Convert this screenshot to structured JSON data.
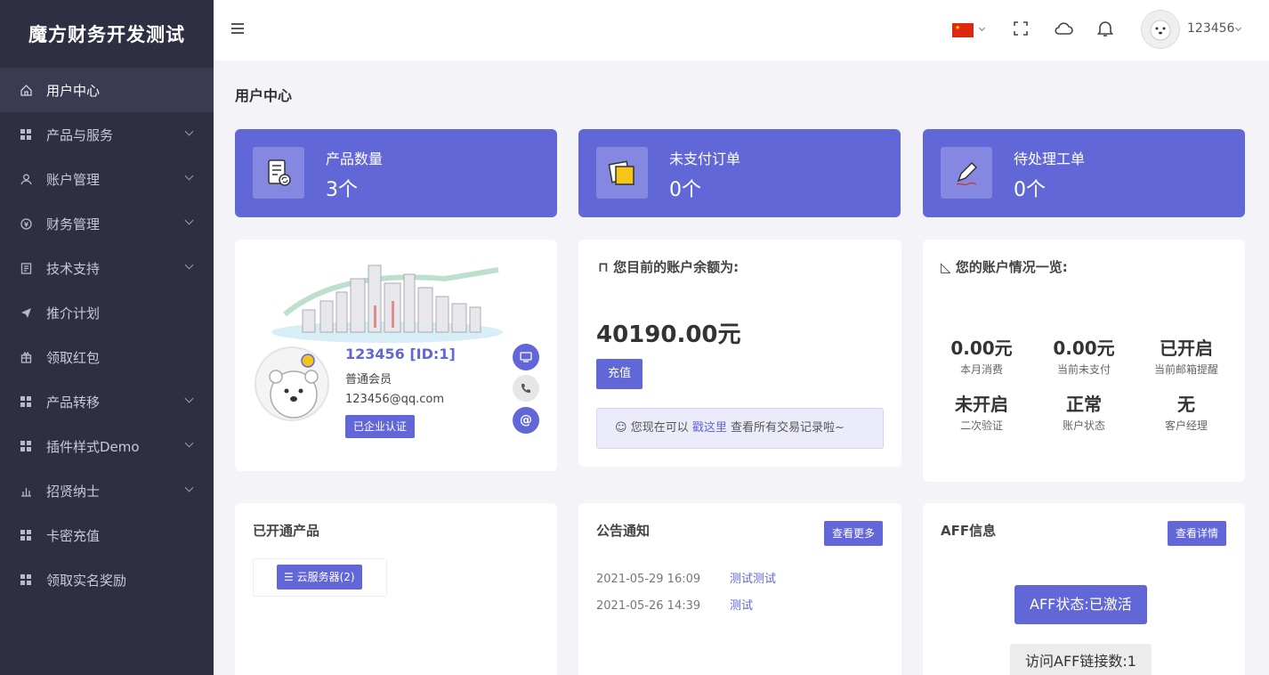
{
  "brand": "魔方财务开发测试",
  "sidebar": {
    "items": [
      {
        "label": "用户中心",
        "icon": "home-icon",
        "active": true,
        "expandable": false
      },
      {
        "label": "产品与服务",
        "icon": "grid-icon",
        "expandable": true
      },
      {
        "label": "账户管理",
        "icon": "user-icon",
        "expandable": true
      },
      {
        "label": "财务管理",
        "icon": "money-icon",
        "expandable": true
      },
      {
        "label": "技术支持",
        "icon": "document-icon",
        "expandable": true
      },
      {
        "label": "推介计划",
        "icon": "send-icon",
        "expandable": false
      },
      {
        "label": "领取红包",
        "icon": "gift-icon",
        "expandable": false
      },
      {
        "label": "产品转移",
        "icon": "grid-icon",
        "expandable": true
      },
      {
        "label": "插件样式Demo",
        "icon": "grid-icon",
        "expandable": true
      },
      {
        "label": "招贤纳士",
        "icon": "bar-chart-icon",
        "expandable": true
      },
      {
        "label": "卡密充值",
        "icon": "grid-icon",
        "expandable": false
      },
      {
        "label": "领取实名奖励",
        "icon": "grid-icon",
        "expandable": false
      }
    ]
  },
  "topbar": {
    "username": "123456",
    "language_flag": "china-flag-icon"
  },
  "page_title": "用户中心",
  "stats": [
    {
      "label": "产品数量",
      "value": "3个",
      "icon": "product-list-icon"
    },
    {
      "label": "未支付订单",
      "value": "0个",
      "icon": "sticky-note-icon"
    },
    {
      "label": "待处理工单",
      "value": "0个",
      "icon": "pen-icon"
    }
  ],
  "profile": {
    "name": "123456 [ID:1]",
    "level": "普通会员",
    "email": "123456@qq.com",
    "verify_label": "已企业认证"
  },
  "balance": {
    "heading": "您目前的账户余额为:",
    "amount": "40190.00元",
    "recharge_label": "充值",
    "tip_prefix": "您现在可以",
    "tip_link": "戳这里",
    "tip_suffix": "查看所有交易记录啦~"
  },
  "overview": {
    "heading": "您的账户情况一览:",
    "items": [
      {
        "value": "0.00元",
        "label": "本月消费"
      },
      {
        "value": "0.00元",
        "label": "当前未支付"
      },
      {
        "value": "已开启",
        "label": "当前邮箱提醒"
      },
      {
        "value": "未开启",
        "label": "二次验证"
      },
      {
        "value": "正常",
        "label": "账户状态"
      },
      {
        "value": "无",
        "label": "客户经理"
      }
    ]
  },
  "products": {
    "heading": "已开通产品",
    "button": "云服务器(2)"
  },
  "notices": {
    "heading": "公告通知",
    "more_label": "查看更多",
    "rows": [
      {
        "date": "2021-05-29 16:09",
        "title": "测试测试"
      },
      {
        "date": "2021-05-26 14:39",
        "title": "测试"
      }
    ]
  },
  "aff": {
    "heading": "AFF信息",
    "detail_label": "查看详情",
    "status": "AFF状态:已激活",
    "visits": "访问AFF链接数:1"
  },
  "colors": {
    "accent": "#6267d8",
    "sidebar": "#2e2f42",
    "background": "#f3f3f8"
  }
}
